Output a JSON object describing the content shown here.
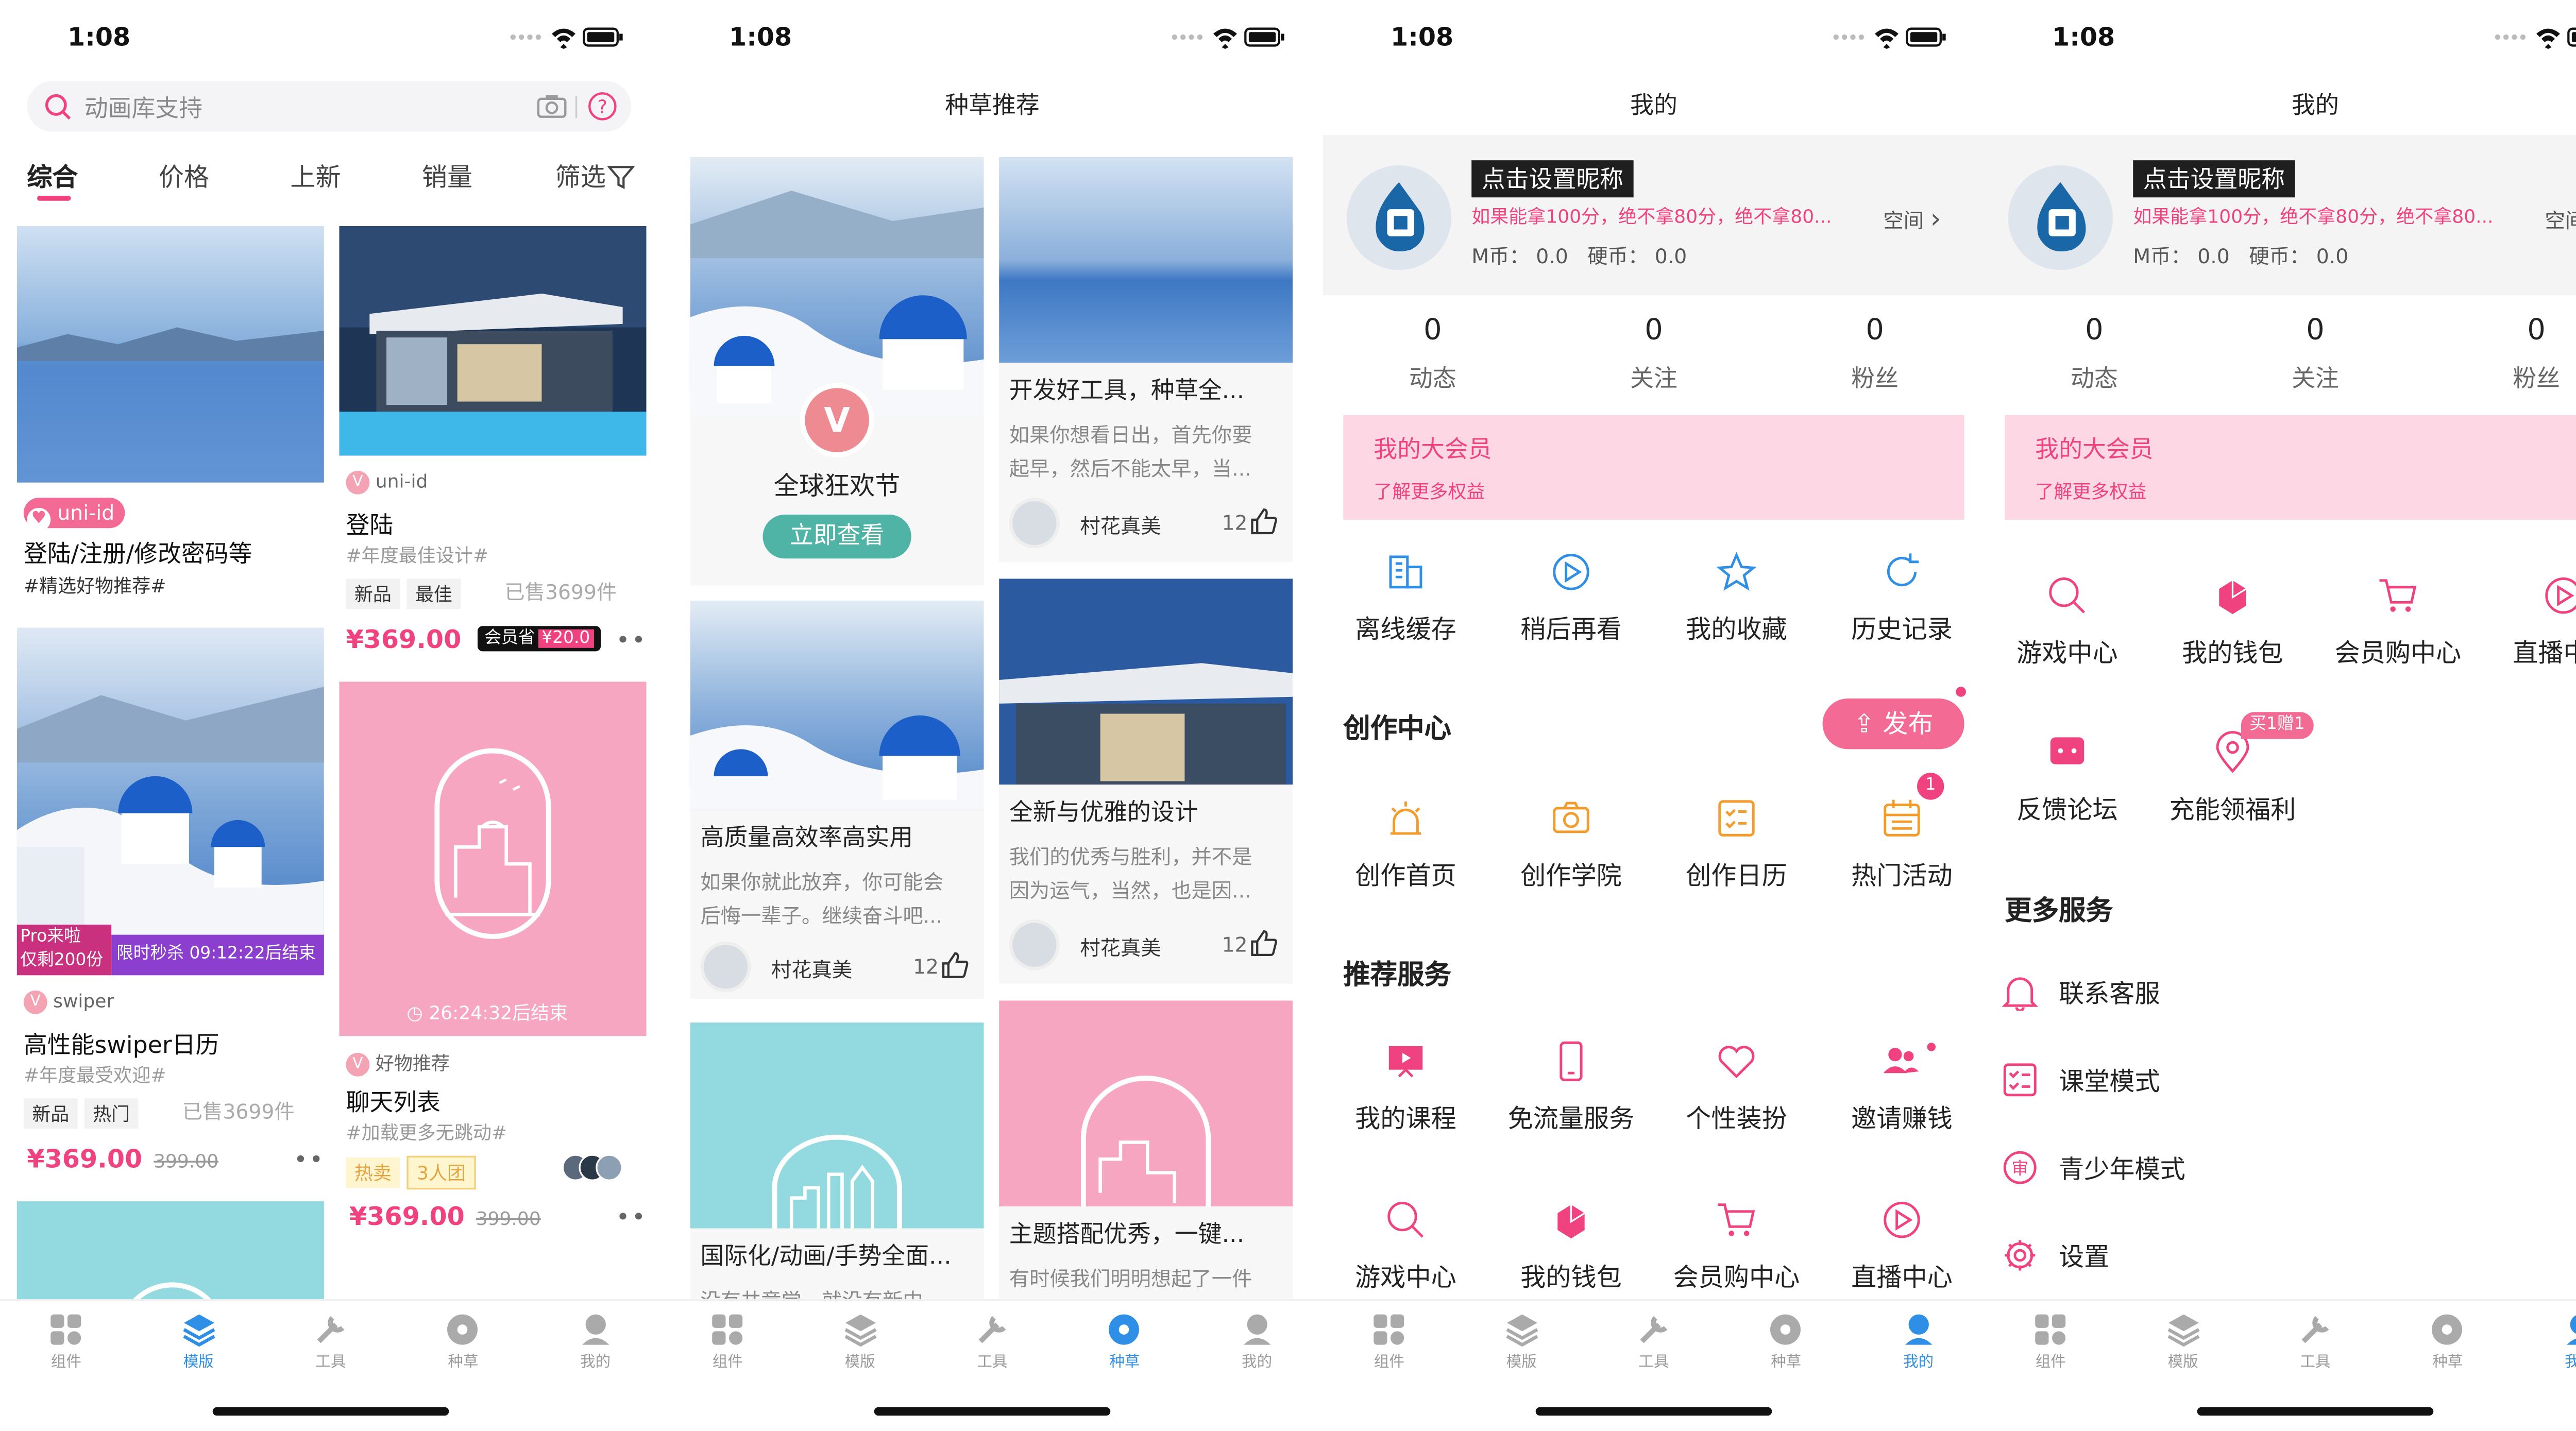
{
  "status": {
    "time": "1:08"
  },
  "tabs": [
    "组件",
    "模版",
    "工具",
    "种草",
    "我的"
  ],
  "colors": {
    "accent": "#f0427f",
    "tab_active": "#2f8fe6"
  },
  "screen1": {
    "search_placeholder": "动画库支持",
    "sorts": [
      "综合",
      "价格",
      "上新",
      "销量",
      "筛选"
    ],
    "cards": [
      {
        "badge": "uni-id",
        "title": "登陆/注册/修改密码等",
        "subtitle": "#精选好物推荐#"
      },
      {
        "source": "uni-id",
        "title": "登陆",
        "subtitle": "#年度最佳设计#",
        "tags": [
          "新品",
          "最佳"
        ],
        "sold": "已售3699件",
        "price": "¥369.00",
        "member": "会员省",
        "member_price": "¥20.0"
      },
      {
        "pro1": "Pro来啦",
        "pro2": "仅剩200份",
        "flash": "限时秒杀 09:12:22后结束",
        "source": "swiper",
        "title": "高性能swiper日历",
        "subtitle": "#年度最受欢迎#",
        "tags": [
          "新品",
          "热门"
        ],
        "sold": "已售3699件",
        "price": "¥369.00",
        "old_price": "399.00"
      },
      {
        "countdown": "26:24:32后结束",
        "source": "好物推荐",
        "title": "聊天列表",
        "subtitle": "#加载更多无跳动#",
        "tags": [
          "热卖",
          "3人团"
        ],
        "price": "¥369.00",
        "old_price": "399.00"
      }
    ]
  },
  "screen2": {
    "title": "种草推荐",
    "promo": {
      "title": "全球狂欢节",
      "button": "立即查看",
      "logo": "V"
    },
    "posts": [
      {
        "title": "开发好工具，种草全...",
        "desc1": "如果你想看日出，首先你要",
        "desc2": "起早，然后不能太早，当...",
        "author": "村花真美",
        "likes": "12"
      },
      {
        "title": "高质量高效率高实用",
        "desc1": "如果你就此放弃，你可能会",
        "desc2": "后悔一辈子。继续奋斗吧...",
        "author": "村花真美",
        "likes": "12"
      },
      {
        "title": "全新与优雅的设计",
        "desc1": "我们的优秀与胜利，并不是",
        "desc2": "因为运气，当然，也是因...",
        "author": "村花真美",
        "likes": "12"
      },
      {
        "title": "国际化/动画/手势全面...",
        "desc1": "没有共竞觉，就没有新中"
      },
      {
        "title": "主题搭配优秀，一键...",
        "desc1": "有时候我们明明想起了一件"
      }
    ]
  },
  "profile": {
    "title": "我的",
    "nickname": "点击设置昵称",
    "signature": "如果能拿100分，绝不拿80分，绝不拿80...",
    "space": "空间",
    "mcoin": "M币：  0.0",
    "hcoin": "硬币：  0.0",
    "stats": [
      {
        "n": "0",
        "l": "动态"
      },
      {
        "n": "0",
        "l": "关注"
      },
      {
        "n": "0",
        "l": "粉丝"
      }
    ],
    "vip_title": "我的大会员",
    "vip_sub": "了解更多权益"
  },
  "screen3": {
    "grid1": [
      "离线缓存",
      "稍后再看",
      "我的收藏",
      "历史记录"
    ],
    "create_title": "创作中心",
    "publish": "发布",
    "grid2": [
      "创作首页",
      "创作学院",
      "创作日历",
      "热门活动"
    ],
    "grid2_badge": "1",
    "rec_title": "推荐服务",
    "grid3": [
      "我的课程",
      "免流量服务",
      "个性装扮",
      "邀请赚钱"
    ],
    "grid4": [
      "游戏中心",
      "我的钱包",
      "会员购中心",
      "直播中心"
    ]
  },
  "screen4": {
    "grid1": [
      "游戏中心",
      "我的钱包",
      "会员购中心",
      "直播中心"
    ],
    "grid2": [
      "反馈论坛",
      "充能领福利"
    ],
    "grid2_badge": "买1赠1",
    "more_title": "更多服务",
    "rows": [
      "联系客服",
      "课堂模式",
      "青少年模式",
      "设置"
    ]
  }
}
